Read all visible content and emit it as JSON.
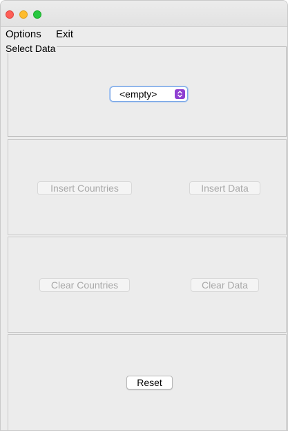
{
  "window": {
    "controls": [
      "close",
      "minimize",
      "zoom"
    ]
  },
  "menubar": {
    "options_label": "Options",
    "exit_label": "Exit"
  },
  "select_panel": {
    "legend": "Select Data",
    "combo_value": "<empty>",
    "combo_icon": "up-down-chevron-icon",
    "accent_color": "#8e3fd1"
  },
  "insert_panel": {
    "insert_countries_label": "Insert Countries",
    "insert_data_label": "Insert Data",
    "enabled": false
  },
  "clear_panel": {
    "clear_countries_label": "Clear Countries",
    "clear_data_label": "Clear Data",
    "enabled": false
  },
  "reset_panel": {
    "reset_label": "Reset",
    "enabled": true
  }
}
